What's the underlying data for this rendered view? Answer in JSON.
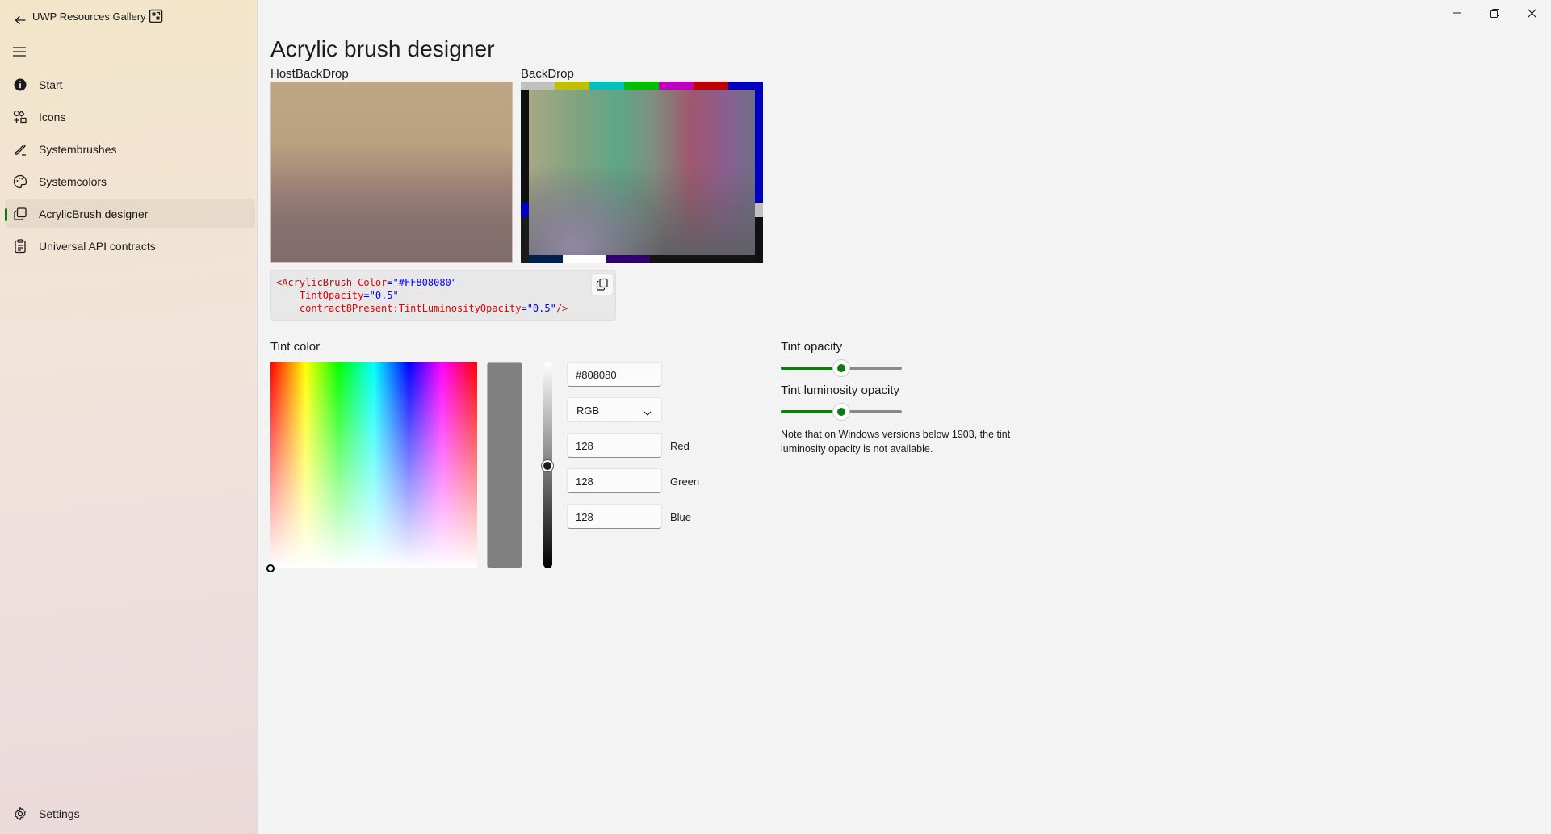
{
  "app": {
    "title": "UWP Resources Gallery",
    "accent": "#0f7b0f"
  },
  "sidebar": {
    "items": [
      {
        "label": "Start",
        "icon": "info-icon"
      },
      {
        "label": "Icons",
        "icon": "icons-icon"
      },
      {
        "label": "Systembrushes",
        "icon": "brush-icon"
      },
      {
        "label": "Systemcolors",
        "icon": "palette-icon"
      },
      {
        "label": "AcrylicBrush designer",
        "icon": "acrylic-icon",
        "selected": true
      },
      {
        "label": "Universal API contracts",
        "icon": "clipboard-icon"
      }
    ],
    "settings_label": "Settings"
  },
  "main": {
    "title": "Acrylic brush designer",
    "host_backdrop_label": "HostBackDrop",
    "backdrop_label": "BackDrop",
    "code": {
      "line1_tag": "<AcrylicBrush ",
      "line1_attr": "Color",
      "line1_eq": "=",
      "line1_val": "\"#FF808080\"",
      "line2_attr": "TintOpacity",
      "line2_eq": "=",
      "line2_val": "\"0.5\"",
      "line3_attr": "contract8Present:TintLuminosityOpacity",
      "line3_eq": "=",
      "line3_val": "\"0.5\"",
      "line3_end": "/>"
    },
    "tint_color_label": "Tint color",
    "hex_value": "#808080",
    "color_mode": "RGB",
    "red_value": "128",
    "green_value": "128",
    "blue_value": "128",
    "red_label": "Red",
    "green_label": "Green",
    "blue_label": "Blue",
    "tint_opacity_label": "Tint opacity",
    "tint_opacity_value": 0.5,
    "tint_luminosity_label": "Tint luminosity opacity",
    "tint_luminosity_value": 0.5,
    "note": "Note that on Windows versions below 1903, the tint luminosity opacity is not available."
  }
}
